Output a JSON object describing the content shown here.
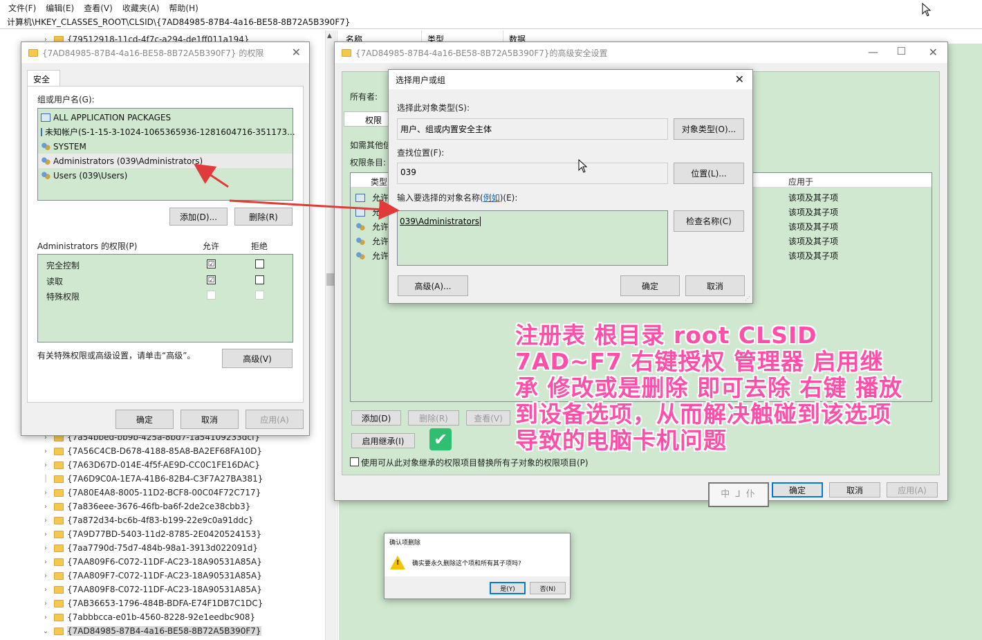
{
  "menu": [
    "文件(F)",
    "编辑(E)",
    "查看(V)",
    "收藏夹(A)",
    "帮助(H)"
  ],
  "address": "计算机\\HKEY_CLASSES_ROOT\\CLSID\\{7AD84985-87B4-4a16-BE58-8B72A5B390F7}",
  "right_pane": {
    "col_name": "名称",
    "col_type": "类型",
    "col_data": "数据"
  },
  "tree": {
    "top_item": "{79512918-11cd-4f7c-a294-de1ff011a194}",
    "items": [
      "{7a54bbed-bb9b-425a-8bd7-1a54109233dcf}",
      "{7A56C4CB-D678-4188-85A8-BA2EF68FA10D}",
      "{7A63D67D-014E-4f5f-AE9D-CC0C1FE16DAC}",
      "{7A6D9C0A-1E7A-41B6-82B4-C3F7A27BA381}",
      "{7A80E4A8-8005-11D2-BCF8-00C04F72C717}",
      "{7a836eee-3676-46fb-ba6f-2de2ce38cbb3}",
      "{7a872d34-bc6b-4f83-b199-22e9c0a91ddc}",
      "{7A9D77BD-5403-11d2-8785-2E0420524153}",
      "{7aa7790d-75d7-484b-98a1-3913d022091d}",
      "{7AA809F6-C072-11DF-AC23-18A90531A85A}",
      "{7AA809F7-C072-11DF-AC23-18A90531A85A}",
      "{7AA809F8-C072-11DF-AC23-18A90531A85A}",
      "{7AB36653-1796-484B-BDFA-E74F1DB7C1DC}",
      "{7abbbcca-e01b-4560-8228-92e1eedbc908}",
      "{7AD84985-87B4-4a16-BE58-8B72A5B390F7}"
    ]
  },
  "perm_dialog": {
    "title": "{7AD84985-87B4-4a16-BE58-8B72A5B390F7} 的权限",
    "tab": "安全",
    "group_label": "组或用户名(G):",
    "users": [
      "ALL APPLICATION PACKAGES",
      "未知帐户(S-1-15-3-1024-1065365936-1281604716-351173...",
      "SYSTEM",
      "Administrators (039\\Administrators)",
      "Users (039\\Users)"
    ],
    "add_btn": "添加(D)...",
    "remove_btn": "删除(R)",
    "perms_label": "Administrators 的权限(P)",
    "allow": "允许",
    "deny": "拒绝",
    "perms": [
      "完全控制",
      "读取",
      "特殊权限"
    ],
    "perm_state": [
      {
        "allow": "☑",
        "deny": ""
      },
      {
        "allow": "☑",
        "deny": ""
      },
      {
        "allow": "",
        "deny": ""
      }
    ],
    "adv_hint": "有关特殊权限或高级设置，请单击“高级”。",
    "adv_btn": "高级(V)",
    "ok": "确定",
    "cancel": "取消",
    "apply": "应用(A)"
  },
  "adv_dialog": {
    "title": "{7AD84985-87B4-4a16-BE58-8B72A5B390F7}的高级安全设置",
    "owner_label": "所有者:",
    "tab_perm": "权限",
    "hint": "如需其他信",
    "entries_label": "权限条目:",
    "col_type": "类型",
    "col_apply": "应用于",
    "rows": [
      "允许",
      "允许",
      "允许",
      "允许",
      "允许"
    ],
    "apply_to": [
      "该项及其子项",
      "该项及其子项",
      "该项及其子项",
      "该项及其子项",
      "该项及其子项"
    ],
    "add_btn": "添加(D)",
    "remove_btn": "删除(R)",
    "view_btn": "查看(V)",
    "inherit_btn": "启用继承(I)",
    "replace_label": "使用可从此对象继承的权限项目替换所有子对象的权限项目(P)",
    "ok": "确定",
    "cancel": "取消",
    "apply": "应用(A)",
    "stamp": "中 ⅃ 仆"
  },
  "select_dialog": {
    "title": "选择用户或组",
    "type_label": "选择此对象类型(S):",
    "type_value": "用户、组或内置安全主体",
    "type_btn": "对象类型(O)...",
    "loc_label": "查找位置(F):",
    "loc_value": "039",
    "loc_btn": "位置(L)...",
    "name_label_a": "输入要选择的对象名称(",
    "name_link": "例如",
    "name_label_b": ")(E):",
    "name_value": "039\\Administrators",
    "check_btn": "检查名称(C)",
    "adv_btn": "高级(A)...",
    "ok": "确定",
    "cancel": "取消"
  },
  "confirm_dialog": {
    "title": "确认项删除",
    "message": "确实要永久删除这个项和所有其子项吗?",
    "yes": "是(Y)",
    "no": "否(N)"
  },
  "annotation": "注册表 根目录 root CLSID 7AD~F7 右键授权 管理器 启用继承  修改或是删除 即可去除 右键 播放到设备选项，从而解决触碰到该选项导致的电脑卡机问题",
  "colors": {
    "green": "#cfe8cf",
    "accent": "#0078d7",
    "arrow": "#e03a3a",
    "annotation": "#ff4fa8"
  }
}
